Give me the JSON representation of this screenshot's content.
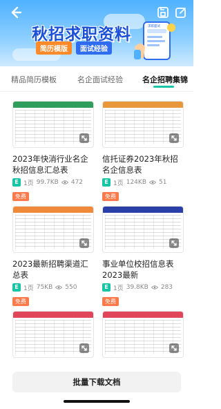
{
  "banner": {
    "title": "秋招求职资料",
    "pills": [
      "简历模版",
      "面试经验"
    ],
    "art_label": "求职面试"
  },
  "tabs": [
    {
      "label": "精品简历模板"
    },
    {
      "label": "名企面试经验"
    },
    {
      "label": "名企招聘集锦"
    }
  ],
  "cards": [
    {
      "title": "2023年快消行业名企秋招信息汇总表",
      "format_badge": "E",
      "pages": "1页",
      "size": "99.7KB",
      "views": "472",
      "free": "免费",
      "accent": "#2f9e5c"
    },
    {
      "title": "信托证券2023年秋招名企信息表",
      "format_badge": "E",
      "pages": "1页",
      "size": "124KB",
      "views": "51",
      "free": "免费",
      "accent": "#e8973a"
    },
    {
      "title": "2023最新招聘渠道汇总表",
      "format_badge": "E",
      "pages": "1页",
      "size": "75KB",
      "views": "550",
      "free": "免费",
      "accent": "#f08a3a"
    },
    {
      "title": "事业单位校招信息表2023最新",
      "format_badge": "E",
      "pages": "1页",
      "size": "39.8KB",
      "views": "283",
      "free": "免费",
      "accent": "#2b3fa8"
    },
    {
      "title": "",
      "format_badge": "",
      "pages": "",
      "size": "",
      "views": "",
      "free": "",
      "accent": "#e0455a"
    },
    {
      "title": "",
      "format_badge": "",
      "pages": "",
      "size": "",
      "views": "",
      "free": "",
      "accent": "#e0455a"
    }
  ],
  "bottom": {
    "batch_download": "批量下载文档"
  },
  "colors": {
    "accent": "#17c5a7",
    "free": "#ff7a4a",
    "banner": "#4fb1ff"
  },
  "icons": [
    "back-arrow-icon",
    "save-icon",
    "edit-icon",
    "expand-icon",
    "eye-icon"
  ]
}
